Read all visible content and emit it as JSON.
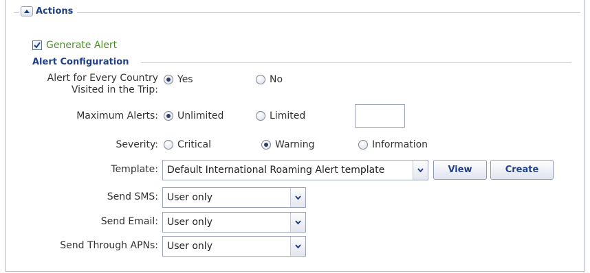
{
  "actions": {
    "title": "Actions"
  },
  "generate_alert": {
    "label": "Generate Alert",
    "checked": true
  },
  "alert_configuration": {
    "title": "Alert Configuration",
    "every_country": {
      "label_line1": "Alert for Every Country",
      "label_line2": "Visited in the Trip:",
      "options": [
        "Yes",
        "No"
      ],
      "selected": "Yes"
    },
    "maximum_alerts": {
      "label": "Maximum Alerts:",
      "options": [
        "Unlimited",
        "Limited"
      ],
      "selected": "Unlimited",
      "limit_value": ""
    },
    "severity": {
      "label": "Severity:",
      "options": [
        "Critical",
        "Warning",
        "Information"
      ],
      "selected": "Warning"
    },
    "template": {
      "label": "Template:",
      "value": "Default International Roaming Alert template",
      "view_label": "View",
      "create_label": "Create"
    },
    "send_sms": {
      "label": "Send SMS:",
      "value": "User only"
    },
    "send_email": {
      "label": "Send Email:",
      "value": "User only"
    },
    "send_apns": {
      "label": "Send Through APNs:",
      "value": "User only"
    }
  },
  "colors": {
    "accent": "#1f3f87",
    "generate_alert_text": "#4e8f2b",
    "border": "#a8afc6"
  },
  "icons": {
    "collapse": "chevron-up-icon",
    "dropdown": "chevron-down-icon",
    "checkbox": "check-icon"
  }
}
